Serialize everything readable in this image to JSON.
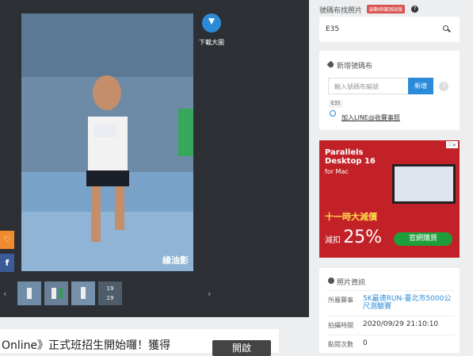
{
  "viewer": {
    "download_label": "下載大圖",
    "watermark": "緣油影",
    "like_icon": "heart-icon",
    "facebook_label": "f",
    "thumbnail_overlay_1": "19",
    "thumbnail_overlay_2": "19",
    "nav_prev": "‹",
    "nav_next": "›"
  },
  "banner": {
    "text": "Online》正式班招生開始囉！獲得",
    "button": "開啟"
  },
  "sidebar": {
    "title": "號碼布找照片",
    "badge": "啟動辨識測試版",
    "help": "?",
    "search_value": "E35"
  },
  "add_bib": {
    "title": "新增號碼布",
    "placeholder": "輸入號碼布編號",
    "button": "新增",
    "help": "?",
    "tag": "E35",
    "line_link": "加入LINE@收賽事照"
  },
  "ad": {
    "close": "ⓘ✕",
    "brand_line1": "Parallels",
    "brand_line2": "Desktop 16",
    "sub": "for Mac",
    "promo": "十一時大減價",
    "discount_prefix": "減扣",
    "discount_value": "25%",
    "buy": "官網購買"
  },
  "photo_info": {
    "title": "照片資訊",
    "rows": [
      {
        "key": "所屬賽事",
        "value": "5K最速RUN-臺北市5000公尺測驗賽"
      },
      {
        "key": "拍攝時間",
        "value": "2020/09/29 21:10:10"
      },
      {
        "key": "點閱次數",
        "value": "0"
      }
    ]
  },
  "colors": {
    "accent": "#2b8bd8",
    "ad_red": "#c22227",
    "badge_red": "#d9534f",
    "like_orange": "#f08a2e",
    "facebook_blue": "#3b5b98"
  }
}
